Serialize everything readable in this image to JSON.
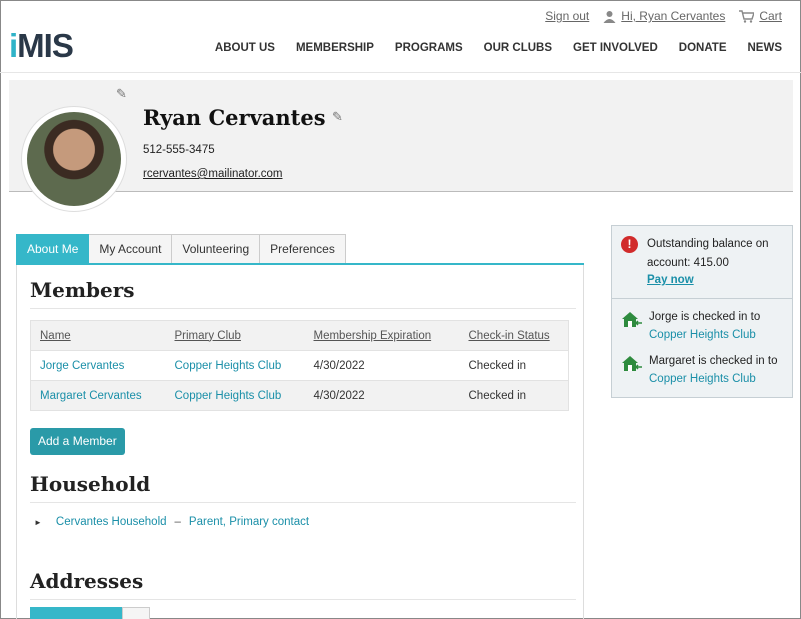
{
  "header": {
    "sign_out": "Sign out",
    "greeting": "Hi, Ryan Cervantes",
    "cart": "Cart",
    "logo": "iMIS",
    "nav": [
      "ABOUT US",
      "MEMBERSHIP",
      "PROGRAMS",
      "OUR CLUBS",
      "GET INVOLVED",
      "DONATE",
      "NEWS"
    ]
  },
  "profile": {
    "name": "Ryan Cervantes",
    "phone": "512-555-3475",
    "email": "rcervantes@mailinator.com"
  },
  "tabs": [
    "About Me",
    "My Account",
    "Volunteering",
    "Preferences"
  ],
  "members": {
    "title": "Members",
    "columns": [
      "Name",
      "Primary Club",
      "Membership Expiration",
      "Check-in Status"
    ],
    "rows": [
      {
        "name": "Jorge Cervantes",
        "club": "Copper Heights Club",
        "expiration": "4/30/2022",
        "status": "Checked in"
      },
      {
        "name": "Margaret Cervantes",
        "club": "Copper Heights Club",
        "expiration": "4/30/2022",
        "status": "Checked in"
      }
    ],
    "add_button": "Add a Member"
  },
  "household": {
    "title": "Household",
    "name": "Cervantes Household",
    "separator": "–",
    "role": "Parent, Primary contact"
  },
  "addresses": {
    "title": "Addresses"
  },
  "sidebar": {
    "balance_text": "Outstanding balance on account: 415.00",
    "pay_now": "Pay now",
    "checkins": [
      {
        "text": "Jorge is checked in to",
        "club": "Copper Heights Club"
      },
      {
        "text": "Margaret is checked in to",
        "club": "Copper Heights Club"
      }
    ]
  },
  "colors": {
    "accent": "#35b7c9",
    "button": "#2a9aa8",
    "link": "#1a8fa8",
    "alert": "#d12b2b",
    "house": "#2e8b3e"
  }
}
